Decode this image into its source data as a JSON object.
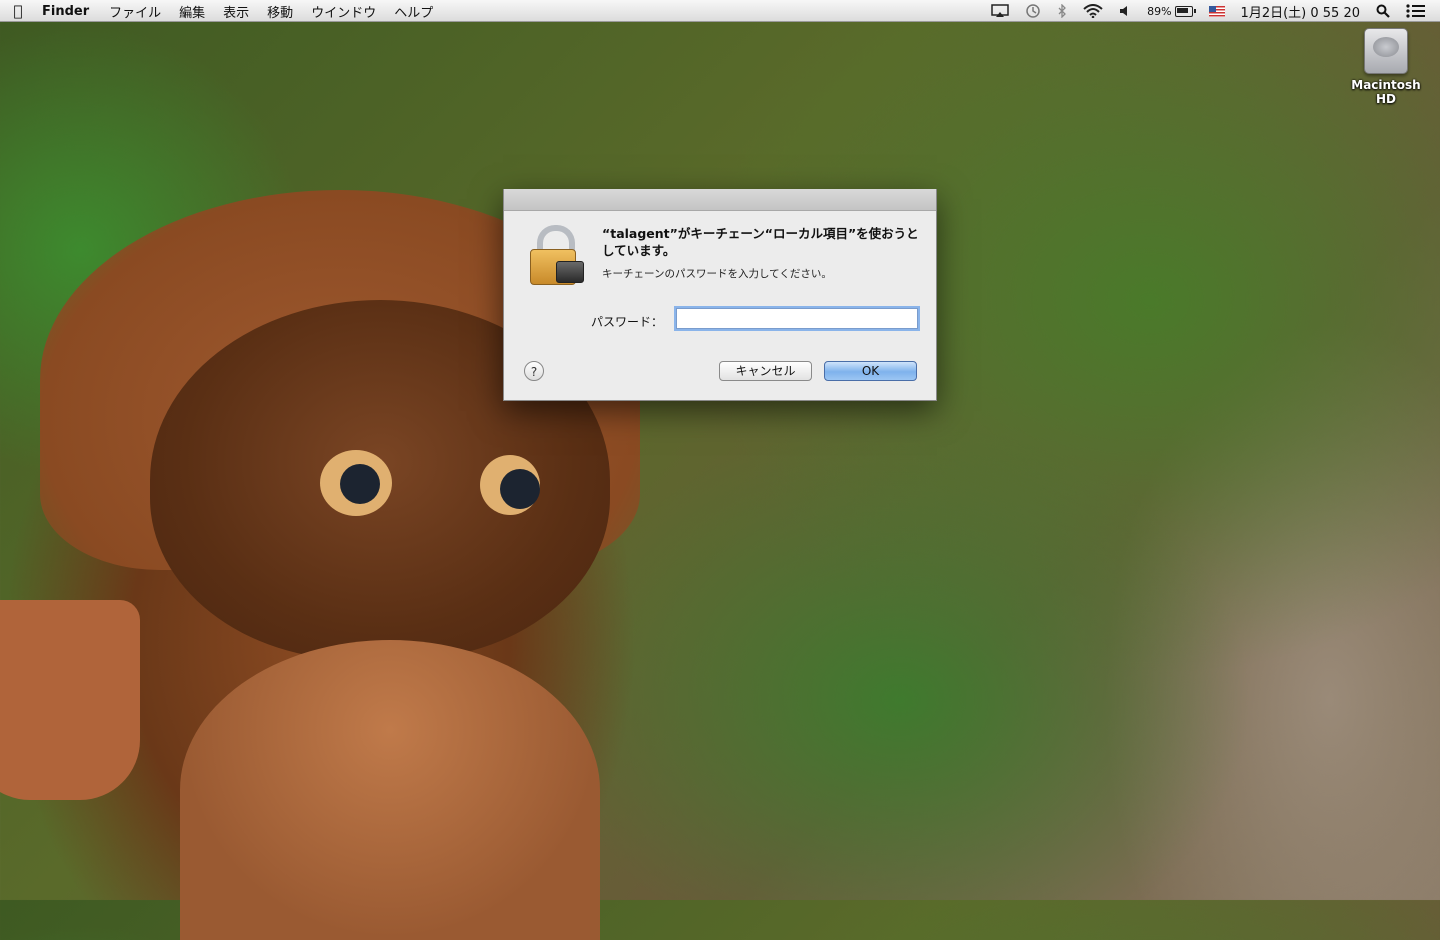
{
  "menubar": {
    "app_name": "Finder",
    "items": [
      "ファイル",
      "編集",
      "表示",
      "移動",
      "ウインドウ",
      "ヘルプ"
    ],
    "battery": "89%",
    "clock": "1月2日(土)  0 55 20"
  },
  "desktop": {
    "drive_label": "Macintosh HD"
  },
  "dialog": {
    "title": "“talagent”がキーチェーン“ローカル項目”を使おうとしています。",
    "message": "キーチェーンのパスワードを入力してください。",
    "password_label": "パスワード：",
    "password_value": "",
    "help": "?",
    "cancel_label": "キャンセル",
    "ok_label": "OK"
  }
}
